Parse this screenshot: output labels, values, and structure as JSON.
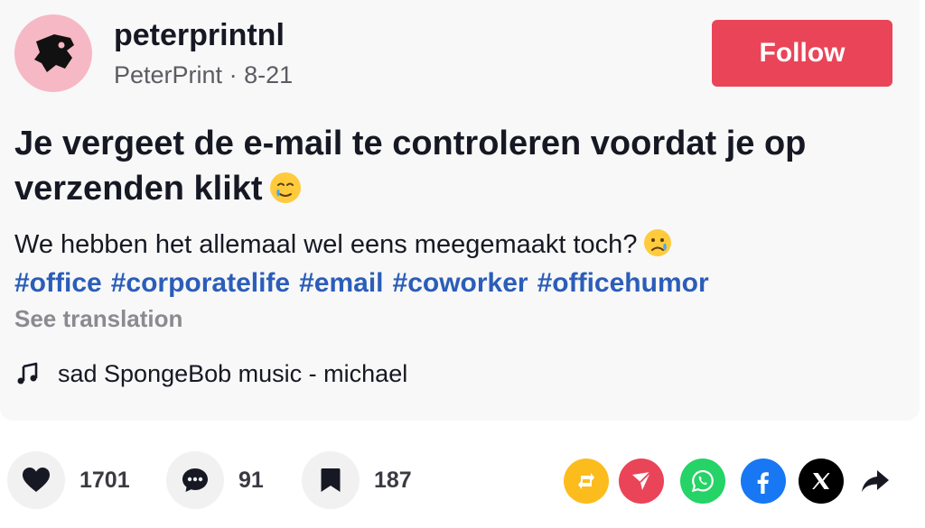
{
  "author": {
    "username": "peterprintnl",
    "nickname": "PeterPrint",
    "separator": " · ",
    "date": "8-21"
  },
  "follow_label": "Follow",
  "post": {
    "title": "Je vergeet de e-mail te controleren voordat je op verzenden klikt",
    "title_emoji": "face-holding-back-tears",
    "description": "We hebben het allemaal wel eens meegemaakt toch?",
    "description_emoji": "crying-face",
    "hashtags": [
      "#office",
      "#corporatelife",
      "#email",
      "#coworker",
      "#officehumor"
    ],
    "see_translation": "See translation"
  },
  "music": {
    "icon": "music-note-icon",
    "label": "sad SpongeBob music - michael"
  },
  "stats": {
    "likes": "1701",
    "comments": "91",
    "saves": "187"
  },
  "share_targets": [
    {
      "icon": "repost-icon",
      "color": "#fcbc1d"
    },
    {
      "icon": "send-icon",
      "color": "#ea4458"
    },
    {
      "icon": "whatsapp-icon",
      "color": "#25d366"
    },
    {
      "icon": "facebook-icon",
      "color": "#1877f2"
    },
    {
      "icon": "x-icon",
      "color": "#000000"
    },
    {
      "icon": "share-arrow-icon",
      "color": "#161823"
    }
  ],
  "colors": {
    "accent": "#ea4458",
    "hashtag": "#2b5db9",
    "avatar_bg": "#f6b8c4"
  }
}
